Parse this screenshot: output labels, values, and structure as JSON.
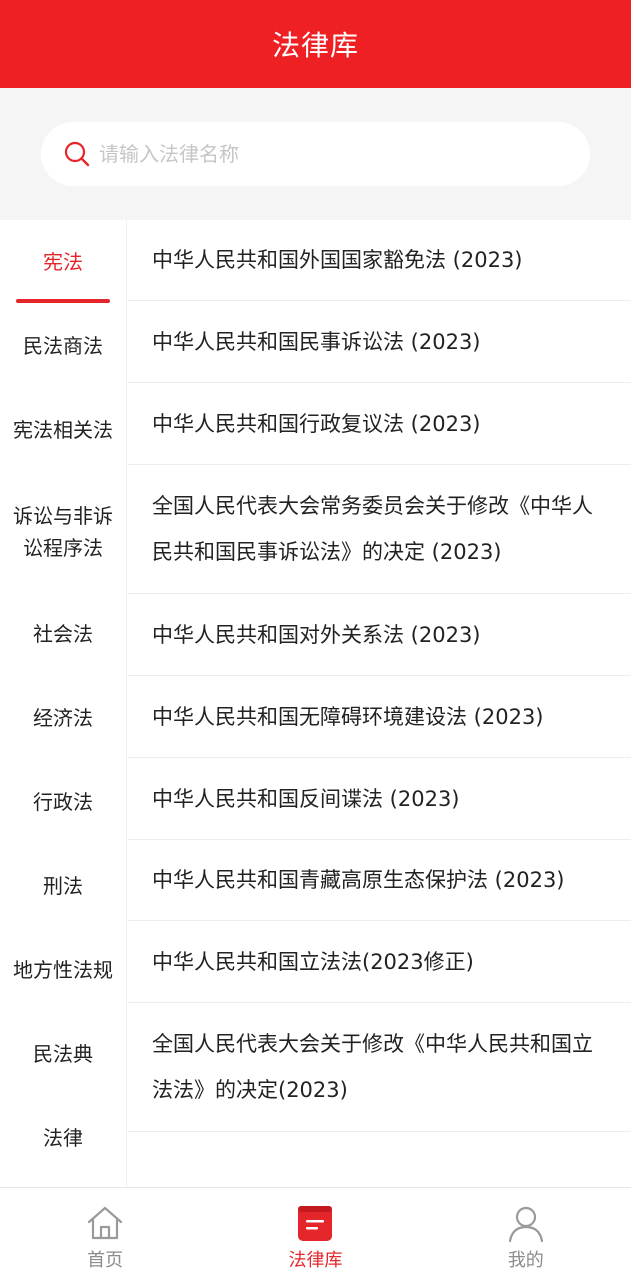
{
  "header": {
    "title": "法律库"
  },
  "search": {
    "placeholder": "请输入法律名称"
  },
  "sidebar": {
    "items": [
      {
        "label": "宪法",
        "active": true
      },
      {
        "label": "民法商法"
      },
      {
        "label": "宪法相关法"
      },
      {
        "label": "诉讼与非诉讼程序法"
      },
      {
        "label": "社会法"
      },
      {
        "label": "经济法"
      },
      {
        "label": "行政法"
      },
      {
        "label": "刑法"
      },
      {
        "label": "地方性法规"
      },
      {
        "label": "民法典"
      },
      {
        "label": "法律"
      }
    ]
  },
  "laws": {
    "items": [
      {
        "title": "中华人民共和国外国国家豁免法 (2023)"
      },
      {
        "title": "中华人民共和国民事诉讼法 (2023)"
      },
      {
        "title": "中华人民共和国行政复议法 (2023)"
      },
      {
        "title": "全国人民代表大会常务委员会关于修改《中华人民共和国民事诉讼法》的决定 (2023)"
      },
      {
        "title": "中华人民共和国对外关系法 (2023)"
      },
      {
        "title": "中华人民共和国无障碍环境建设法 (2023)"
      },
      {
        "title": "中华人民共和国反间谍法 (2023)"
      },
      {
        "title": "中华人民共和国青藏高原生态保护法 (2023)"
      },
      {
        "title": "中华人民共和国立法法(2023修正)"
      },
      {
        "title": "全国人民代表大会关于修改《中华人民共和国立法法》的决定(2023)"
      }
    ]
  },
  "tabbar": {
    "tabs": [
      {
        "label": "首页",
        "icon": "home-icon"
      },
      {
        "label": "法律库",
        "icon": "book-icon",
        "active": true
      },
      {
        "label": "我的",
        "icon": "user-icon"
      }
    ]
  },
  "colors": {
    "brand": "#ee2024",
    "accent": "#e4262b",
    "inactive": "#8c8c8c"
  }
}
